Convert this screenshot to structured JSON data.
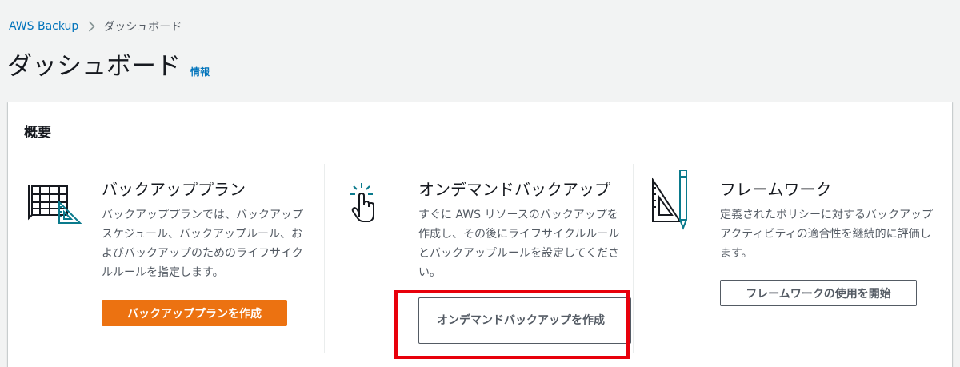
{
  "breadcrumb": {
    "service": "AWS Backup",
    "current": "ダッシュボード"
  },
  "page": {
    "title": "ダッシュボード",
    "info": "情報"
  },
  "overview": {
    "title": "概要",
    "columns": [
      {
        "icon": "blueprint-ruler-icon",
        "title": "バックアッププラン",
        "description": "バックアッププランでは、バックアップスケジュール、バックアップルール、およびバックアップのためのライフサイクルルールを指定します。",
        "button": "バックアッププランを作成"
      },
      {
        "icon": "hand-pointer-icon",
        "title": "オンデマンドバックアップ",
        "description": "すぐに AWS リソースのバックアップを作成し、その後にライフサイクルルールとバックアップルールを設定してください。",
        "button": "オンデマンドバックアップを作成"
      },
      {
        "icon": "triangle-ruler-pencil-icon",
        "title": "フレームワーク",
        "description": "定義されたポリシーに対するバックアップアクティビティの適合性を継続的に評価します。",
        "button": "フレームワークの使用を開始"
      }
    ]
  },
  "colors": {
    "link": "#0073bb",
    "primary": "#ec7211",
    "highlight": "#e8000b",
    "icon_teal": "#0a7a8c"
  }
}
